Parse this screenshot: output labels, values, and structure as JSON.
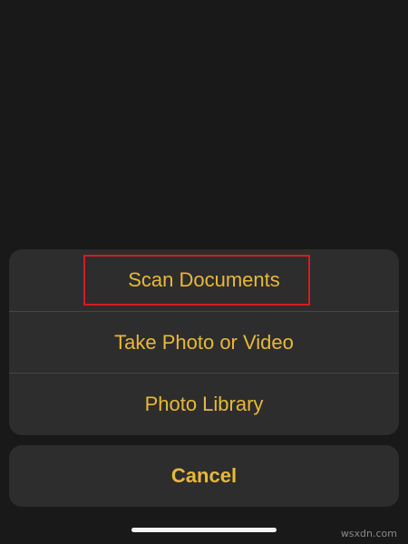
{
  "action_sheet": {
    "items": [
      {
        "label": "Scan Documents",
        "highlighted": true
      },
      {
        "label": "Take Photo or Video",
        "highlighted": false
      },
      {
        "label": "Photo Library",
        "highlighted": false
      }
    ],
    "cancel_label": "Cancel"
  },
  "watermark": "wsxdn.com",
  "colors": {
    "background": "#191919",
    "sheet": "#2d2d2d",
    "accent_text": "#e8b83a",
    "divider": "#454545",
    "highlight": "#d31e1e",
    "home_indicator": "#f5f5f5"
  }
}
